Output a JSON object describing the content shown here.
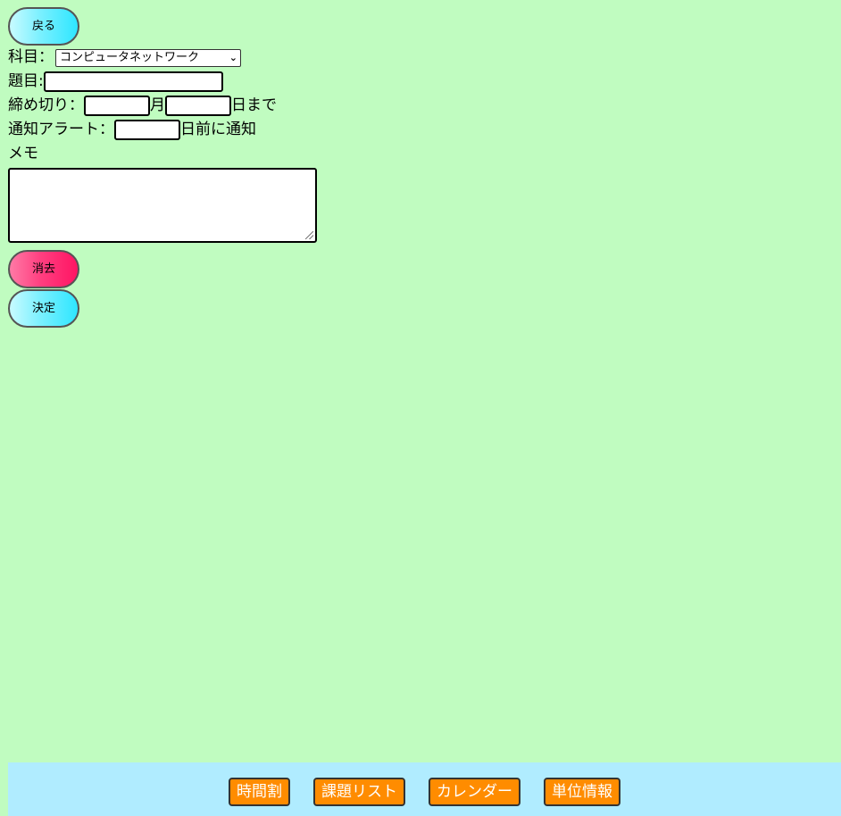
{
  "header": {
    "back_label": "戻る"
  },
  "form": {
    "subject_label": "科目：",
    "subject_value": "コンピュータネットワーク",
    "title_label": "題目:",
    "title_value": "",
    "deadline_label": "締め切り：",
    "month_value": "",
    "month_unit": "月",
    "day_value": "",
    "day_unit": "日まで",
    "alert_label": "通知アラート：",
    "alert_value": "",
    "alert_unit": "日前に通知",
    "memo_label": "メモ",
    "memo_value": ""
  },
  "actions": {
    "clear_label": "消去",
    "submit_label": "決定"
  },
  "footer": {
    "items": [
      {
        "label": "時間割"
      },
      {
        "label": "課題リスト"
      },
      {
        "label": "カレンダー"
      },
      {
        "label": "単位情報"
      }
    ]
  },
  "colors": {
    "page_background": "#c0fcc0",
    "footer_background": "#b0ecff",
    "nav_button": "#ff8c00",
    "cyan_button": "#2ee6ff",
    "pink_button": "#ff1463"
  }
}
